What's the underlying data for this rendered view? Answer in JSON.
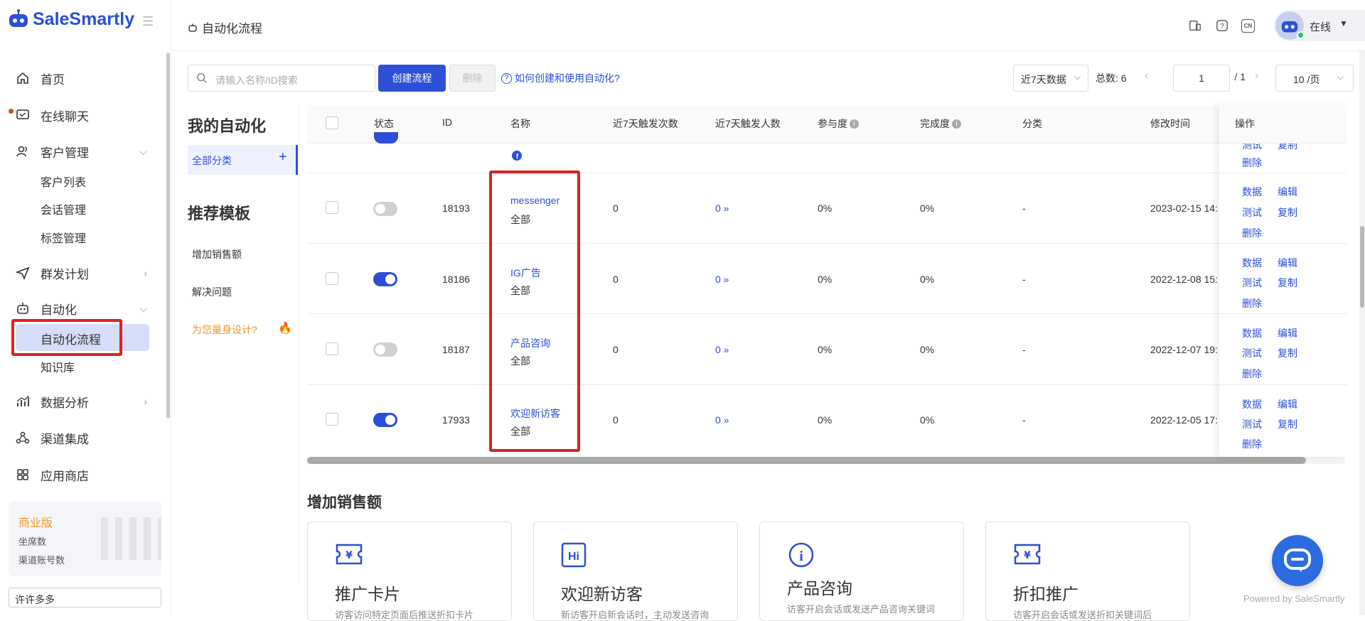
{
  "brand": {
    "name": "SaleSmartly"
  },
  "sidebar": {
    "items": {
      "home": "首页",
      "chat": "在线聊天",
      "customers": "客户管理",
      "customer_list": "客户列表",
      "sessions": "会话管理",
      "tags": "标签管理",
      "broadcast": "群发计划",
      "automation": "自动化",
      "automation_flow": "自动化流程",
      "knowledge": "知识库",
      "analytics": "数据分析",
      "channels": "渠道集成",
      "app_store": "应用商店"
    },
    "plan": {
      "name": "商业版",
      "seats_label": "坐席数",
      "channel_accounts_label": "渠道账号数"
    },
    "user_input_value": "许许多多"
  },
  "topbar": {
    "breadcrumb": "自动化流程",
    "lang": "CN",
    "status": "在线"
  },
  "toolbar": {
    "search_placeholder": "请输入名称/ID搜索",
    "create_label": "创建流程",
    "delete_label": "删除",
    "help_link": "如何创建和使用自动化?",
    "range_label": "近7天数据",
    "total_label": "总数: 6",
    "page_value": "1",
    "page_total": "/ 1",
    "page_size": "10 /页"
  },
  "left_panel": {
    "my_automation": "我的自动化",
    "all_category": "全部分类",
    "templates_title": "推荐模板",
    "tpl_sales": "增加销售额",
    "tpl_solve": "解决问题",
    "tpl_custom": "为您量身设计?"
  },
  "table": {
    "headers": {
      "status": "状态",
      "id": "ID",
      "name": "名称",
      "triggers": "近7天触发次数",
      "people": "近7天触发人数",
      "participation": "参与度",
      "completion": "完成度",
      "category": "分类",
      "modified": "修改时间",
      "actions": "操作"
    },
    "partial_row": {
      "op_test": "测试",
      "op_copy": "复制",
      "op_delete": "删除"
    },
    "rows": [
      {
        "enabled": false,
        "id": "18193",
        "name": "messenger",
        "group": "全部",
        "triggers": "0",
        "people": "0 »",
        "participation": "0%",
        "completion": "0%",
        "category": "-",
        "modified": "2023-02-15 14:",
        "op_data": "数据",
        "op_edit": "编辑",
        "op_test": "测试",
        "op_copy": "复制",
        "op_delete": "删除"
      },
      {
        "enabled": true,
        "id": "18186",
        "name": "IG广告",
        "group": "全部",
        "triggers": "0",
        "people": "0 »",
        "participation": "0%",
        "completion": "0%",
        "category": "-",
        "modified": "2022-12-08 15:",
        "op_data": "数据",
        "op_edit": "编辑",
        "op_test": "测试",
        "op_copy": "复制",
        "op_delete": "删除"
      },
      {
        "enabled": false,
        "id": "18187",
        "name": "产品咨询",
        "group": "全部",
        "triggers": "0",
        "people": "0 »",
        "participation": "0%",
        "completion": "0%",
        "category": "-",
        "modified": "2022-12-07 19:",
        "op_data": "数据",
        "op_edit": "编辑",
        "op_test": "测试",
        "op_copy": "复制",
        "op_delete": "删除"
      },
      {
        "enabled": true,
        "id": "17933",
        "name": "欢迎新访客",
        "group": "全部",
        "triggers": "0",
        "people": "0 »",
        "participation": "0%",
        "completion": "0%",
        "category": "-",
        "modified": "2022-12-05 17:",
        "op_data": "数据",
        "op_edit": "编辑",
        "op_test": "测试",
        "op_copy": "复制",
        "op_delete": "删除"
      }
    ]
  },
  "section": {
    "title": "增加销售额",
    "cards": [
      {
        "title": "推广卡片",
        "desc": "访客访问特定页面后推送折扣卡片"
      },
      {
        "title": "欢迎新访客",
        "desc": "新访客开启新会话时，主动发送咨询"
      },
      {
        "title": "产品咨询",
        "desc": "访客开启会话或发送产品咨询关键词"
      },
      {
        "title": "折扣推广",
        "desc": "访客开启会话或发送折扣关键词后"
      }
    ]
  },
  "footer": {
    "powered": "Powered by SaleSmartly"
  },
  "colors": {
    "accent": "#2d4fd8",
    "highlight": "#e02020",
    "plan_orange": "#f0962a"
  }
}
